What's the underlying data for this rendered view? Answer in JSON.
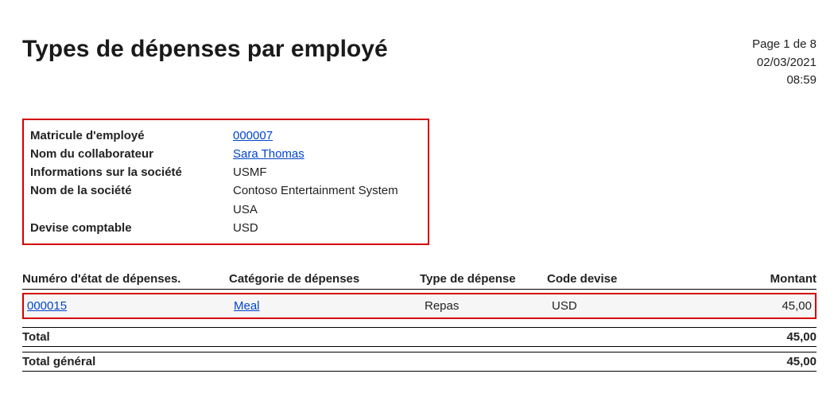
{
  "header": {
    "title": "Types de dépenses par employé",
    "page_label": "Page 1 de 8",
    "date": "02/03/2021",
    "time": "08:59"
  },
  "info": {
    "employee_id_label": "Matricule d'employé",
    "employee_id_value": "000007",
    "collaborator_label": "Nom du collaborateur",
    "collaborator_value": "Sara Thomas",
    "company_info_label": "Informations sur la société",
    "company_info_value": "USMF",
    "company_name_label": "Nom de la société",
    "company_name_value": "Contoso Entertainment System USA",
    "currency_label": "Devise comptable",
    "currency_value": "USD"
  },
  "table": {
    "headers": {
      "report": "Numéro d'état de dépenses.",
      "category": "Catégorie de dépenses",
      "type": "Type de dépense",
      "currency": "Code devise",
      "amount": "Montant"
    },
    "row": {
      "report": "000015",
      "category": "Meal",
      "type": "Repas",
      "currency": "USD",
      "amount": "45,00"
    }
  },
  "totals": {
    "total_label": "Total",
    "total_value": "45,00",
    "grand_total_label": "Total général",
    "grand_total_value": "45,00"
  }
}
